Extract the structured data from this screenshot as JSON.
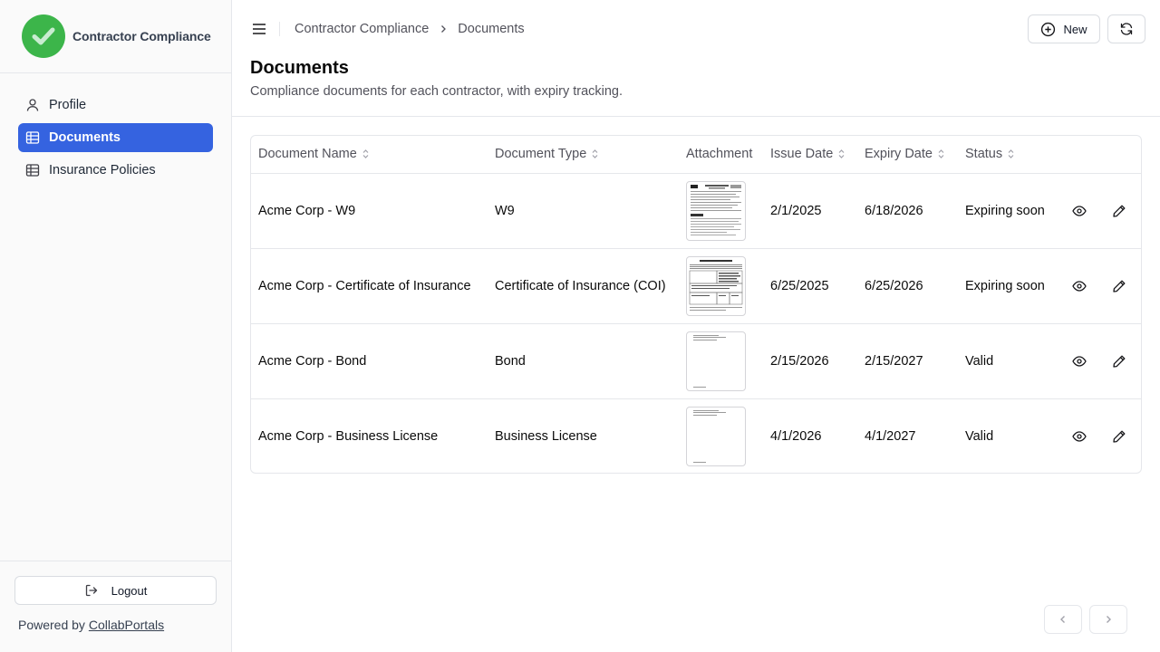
{
  "app": {
    "name": "Contractor Compliance",
    "brand_color": "#3cb54a",
    "accent_color": "#3563e0"
  },
  "sidebar": {
    "items": [
      {
        "label": "Profile",
        "icon": "user-icon"
      },
      {
        "label": "Documents",
        "icon": "table-icon",
        "active": true
      },
      {
        "label": "Insurance Policies",
        "icon": "table-icon"
      }
    ],
    "logout_label": "Logout",
    "powered_prefix": "Powered by ",
    "powered_link": "CollabPortals"
  },
  "header": {
    "breadcrumb": [
      "Contractor Compliance",
      "Documents"
    ],
    "new_label": "New"
  },
  "page": {
    "title": "Documents",
    "subtitle": "Compliance documents for each contractor, with expiry tracking."
  },
  "table": {
    "columns": [
      "Document Name",
      "Document Type",
      "Attachment",
      "Issue Date",
      "Expiry Date",
      "Status"
    ],
    "rows": [
      {
        "name": "Acme Corp - W9",
        "type": "W9",
        "attachment": "w9-form",
        "issue": "2/1/2025",
        "expiry": "6/18/2026",
        "status": "Expiring soon"
      },
      {
        "name": "Acme Corp - Certificate of Insurance",
        "type": "Certificate of Insurance (COI)",
        "attachment": "coi-form",
        "issue": "6/25/2025",
        "expiry": "6/25/2026",
        "status": "Expiring soon"
      },
      {
        "name": "Acme Corp - Bond",
        "type": "Bond",
        "attachment": "blank-doc",
        "issue": "2/15/2026",
        "expiry": "2/15/2027",
        "status": "Valid"
      },
      {
        "name": "Acme Corp - Business License",
        "type": "Business License",
        "attachment": "blank-doc",
        "issue": "4/1/2026",
        "expiry": "4/1/2027",
        "status": "Valid"
      }
    ]
  }
}
